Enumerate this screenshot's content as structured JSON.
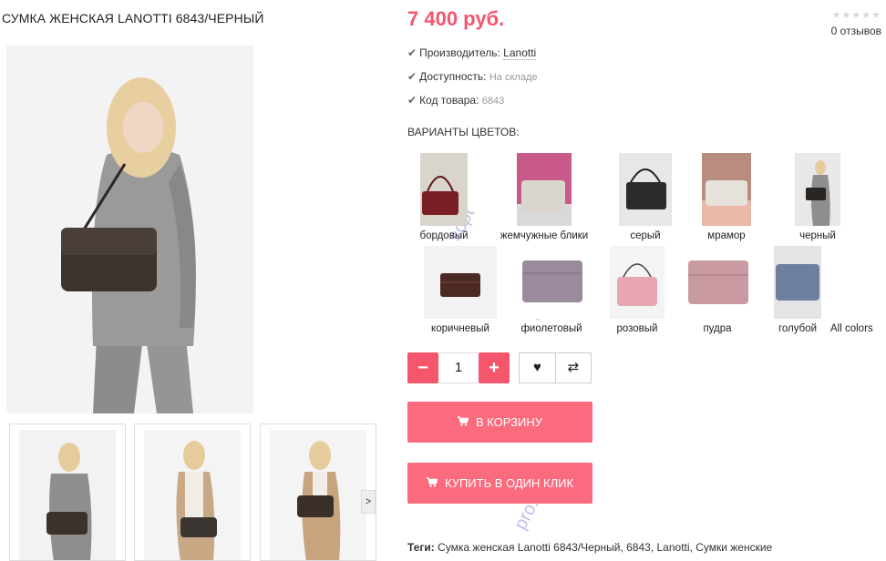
{
  "product": {
    "title": "СУМКА ЖЕНСКАЯ LANOTTI 6843/ЧЕРНЫЙ",
    "price": "7 400 руб.",
    "reviews": "0 отзывов",
    "stars": "★★★★★"
  },
  "specs": [
    {
      "label": "Производитель:",
      "value": "Lanotti"
    },
    {
      "label": "Доступность:",
      "value": "На складе"
    },
    {
      "label": "Код товара:",
      "value": "6843"
    }
  ],
  "variants": {
    "label": "ВАРИАНТЫ ЦВЕТОВ:",
    "items": [
      {
        "label": "бордовый",
        "color": "#7a1f25",
        "bg": "#d9d4cc"
      },
      {
        "label": "жемчужные блики",
        "color": "#dad6cf",
        "bg": "#c85a8a"
      },
      {
        "label": "серый",
        "color": "#2b2b2b",
        "bg": "#e7e7e7"
      },
      {
        "label": "мрамор",
        "color": "#e6e2dc",
        "bg": "#b88d80"
      },
      {
        "label": "черный",
        "color": "#2a2624",
        "bg": "#e8e8e8"
      },
      {
        "label": "коричневый",
        "color": "#4a2a22",
        "bg": "#f2f2f2"
      },
      {
        "label": "фиолетовый",
        "color": "#9a8a9c",
        "bg": "#ffffff"
      },
      {
        "label": "розовый",
        "color": "#e8a6b2",
        "bg": "#f4f4f4"
      },
      {
        "label": "пудра",
        "color": "#c99aa2",
        "bg": "#ffffff"
      },
      {
        "label": "голубой",
        "color": "#6e7fa0",
        "bg": "#e4e4e4"
      }
    ],
    "all_colors": "All colors"
  },
  "quantity": {
    "value": "1",
    "minus": "−",
    "plus": "+"
  },
  "actions": {
    "wishlist_icon": "♥",
    "compare_icon": "⇄",
    "thumb_next": ">"
  },
  "buttons": {
    "cart": "В КОРЗИНУ",
    "one_click": "КУПИТЬ В ОДИН КЛИК",
    "cart_icon": "🛒"
  },
  "tags": {
    "label": "Теги:",
    "value": "Сумка женская Lanotti 6843/Черный, 6843, Lanotti, Сумки женские"
  }
}
